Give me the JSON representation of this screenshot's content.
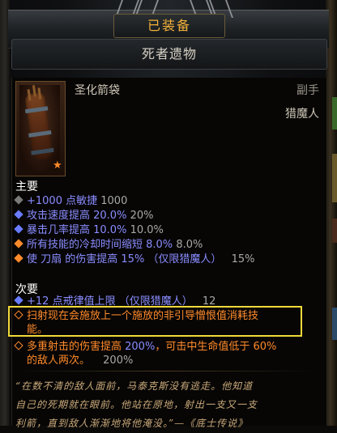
{
  "header": {
    "tab_label": "已装备"
  },
  "item": {
    "name": "死者遗物",
    "type": "圣化箭袋",
    "slot": "副手",
    "class": "猎魔人",
    "icon": "quiver-icon",
    "quality_icon": "star-icon"
  },
  "primary": {
    "title": "主要",
    "stats": [
      {
        "bullet": "grey",
        "text": "+1000 点敏捷",
        "value": "1000"
      },
      {
        "bullet": "blue",
        "text": "攻击速度提高 20.0%",
        "value": "20%"
      },
      {
        "bullet": "blue",
        "text": "暴击几率提高 10.0%",
        "value": "10.0%"
      },
      {
        "bullet": "orange",
        "text": "所有技能的冷却时间缩短 8.0%",
        "value": "8.0%"
      },
      {
        "bullet": "orange",
        "text": "使 刀扇 的伤害提高 15% （仅限猎魔人）",
        "value": "15%"
      }
    ]
  },
  "secondary": {
    "title": "次要",
    "stats": [
      {
        "bullet": "blue",
        "text": "+12 点戒律值上限 （仅限猎魔人）",
        "value": "12"
      },
      {
        "bullet": "hollow",
        "line1": "扫射现在会施放上一个施放的非引导憎恨值消耗技",
        "line2": "能。"
      },
      {
        "bullet": "hollow",
        "line1a": "多重射击的伤害提高 ",
        "line1b": "200%",
        "line1c": "，可击中生命值低于 60%",
        "line2": "的敌人两次。",
        "value": "200%"
      }
    ]
  },
  "flavor": {
    "line1": "“在数不清的敌人面前，马泰克斯没有逃走。他知道",
    "line2": "自己的死期就在眼前。他站在原地，射出一支又一支",
    "line3": "利箭，直到敌人渐渐地将他淹没。”—《底士传说》"
  },
  "colors": {
    "title_gold": "#f2b13a",
    "magic_blue": "#8a8cff",
    "legendary_orange": "#ff8a2a",
    "highlight_yellow": "#f2d93a"
  }
}
